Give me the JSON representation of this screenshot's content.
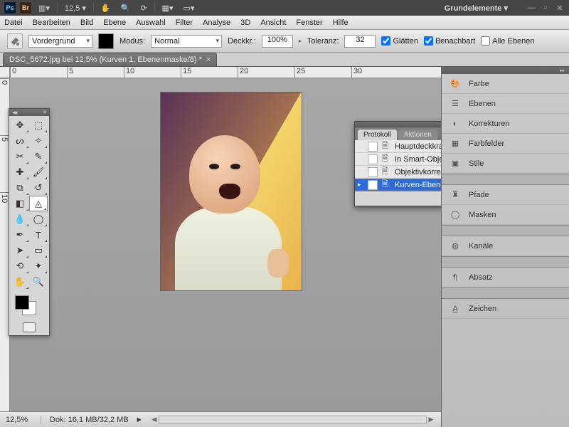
{
  "titlebar": {
    "ps": "Ps",
    "br": "Br",
    "zoom_pct": "12,5",
    "workspace": "Grundelemente"
  },
  "menu": {
    "datei": "Datei",
    "bearbeiten": "Bearbeiten",
    "bild": "Bild",
    "ebene": "Ebene",
    "auswahl": "Auswahl",
    "filter": "Filter",
    "analyse": "Analyse",
    "dreid": "3D",
    "ansicht": "Ansicht",
    "fenster": "Fenster",
    "hilfe": "Hilfe"
  },
  "options": {
    "fill_target": "Vordergrund",
    "modus_label": "Modus:",
    "modus_value": "Normal",
    "deckkr_label": "Deckkr.:",
    "deckkr_value": "100%",
    "toleranz_label": "Toleranz:",
    "toleranz_value": "32",
    "glaetten": "Glätten",
    "benachbart": "Benachbart",
    "alle_ebenen": "Alle Ebenen"
  },
  "doc": {
    "tab_title": "DSC_5672.jpg bei 12,5% (Kurven 1, Ebenenmaske/8) *"
  },
  "ruler_h": [
    "0",
    "5",
    "10",
    "15",
    "20",
    "25",
    "30"
  ],
  "ruler_v": [
    "0",
    "5",
    "10"
  ],
  "history": {
    "tab_protokoll": "Protokoll",
    "tab_aktionen": "Aktionen",
    "items": [
      {
        "label": "Hauptdeckkraft ändern"
      },
      {
        "label": "In Smart-Objekt konvertie..."
      },
      {
        "label": "Objektivkorrektur"
      },
      {
        "label": "Kurven-Ebene verändern"
      }
    ]
  },
  "right": {
    "farbe": "Farbe",
    "ebenen": "Ebenen",
    "korrekturen": "Korrekturen",
    "farbfelder": "Farbfelder",
    "stile": "Stile",
    "pfade": "Pfade",
    "masken": "Masken",
    "kanaele": "Kanäle",
    "absatz": "Absatz",
    "zeichen": "Zeichen"
  },
  "status": {
    "zoom": "12,5%",
    "doc_info": "Dok: 16,1 MB/32,2 MB"
  }
}
